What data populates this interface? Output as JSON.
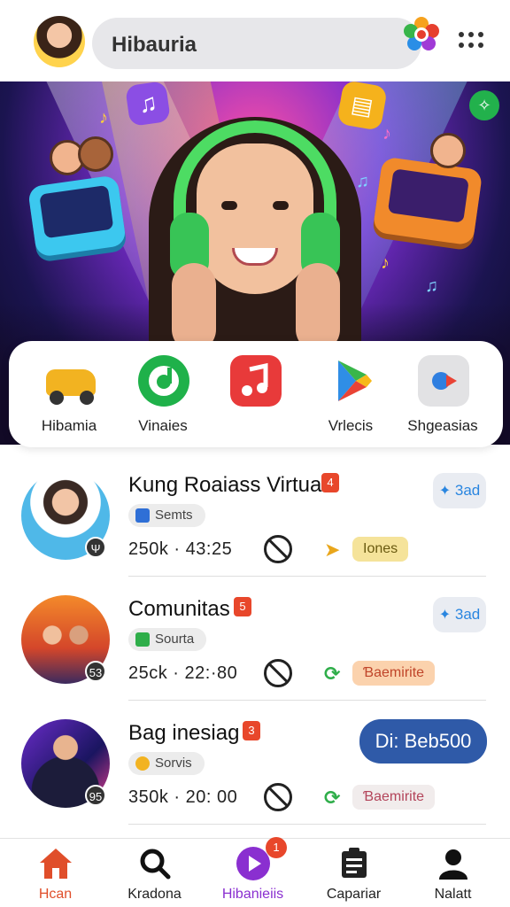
{
  "header": {
    "search_text": "Hibauria",
    "icons": {
      "avatar": "user-avatar",
      "flower": "flower-logo-icon",
      "menu": "grid-dots-icon"
    }
  },
  "hero": {
    "icons": [
      "music-note-icon",
      "shopping-bag-icon",
      "tablet-icon",
      "radio-icon",
      "green-star-icon"
    ]
  },
  "quick_apps": [
    {
      "label": "Hibamia",
      "icon": "car-icon"
    },
    {
      "label": "Vinaies",
      "icon": "green-music-icon"
    },
    {
      "label": "Vrlecis",
      "icon": "play-store-icon"
    },
    {
      "label": "Shgeasias",
      "icon": "video-icon"
    }
  ],
  "list": [
    {
      "title": "Kung Roaiass Virtua",
      "count": "4",
      "tag": "Semts",
      "stats": "250k · 43:25",
      "thumb_badge": "Ψ",
      "action_label": "3ad",
      "status_label": "Iones",
      "status_color": "#f5e39a",
      "status_text_color": "#6a5a10"
    },
    {
      "title": "Comunitas",
      "count": "5",
      "tag": "Sourta",
      "stats": "25ck · 22:·80",
      "thumb_badge": "53",
      "action_label": "3ad",
      "status_label": "Ɓaemirite",
      "status_color": "#fbd2ad",
      "status_text_color": "#c0452a"
    },
    {
      "title": "Bag inesiag",
      "count": "3",
      "tag": "Sorvis",
      "stats": "350k · 20: 00",
      "thumb_badge": "95",
      "action_label": "Di: Beb500",
      "status_label": "Ɓaemirite",
      "status_color": "#f1ecec",
      "status_text_color": "#b3445a"
    }
  ],
  "bottom_nav": [
    {
      "label": "Hcan",
      "icon": "home-icon"
    },
    {
      "label": "Kradona",
      "icon": "search-icon"
    },
    {
      "label": "Hibanieiis",
      "icon": "play-icon",
      "badge": "1"
    },
    {
      "label": "Capariar",
      "icon": "notes-icon"
    },
    {
      "label": "Nalatt",
      "icon": "profile-icon"
    }
  ]
}
